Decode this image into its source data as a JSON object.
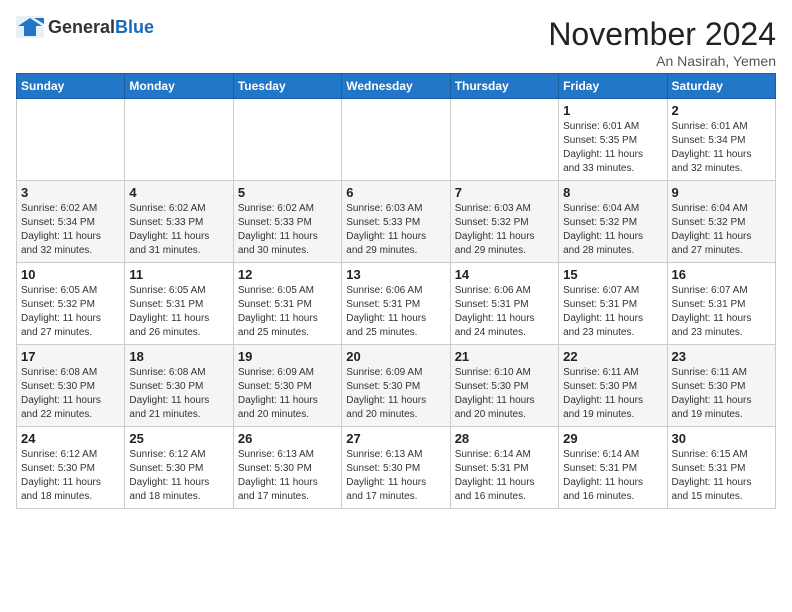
{
  "header": {
    "logo_general": "General",
    "logo_blue": "Blue",
    "month": "November 2024",
    "location": "An Nasirah, Yemen"
  },
  "weekdays": [
    "Sunday",
    "Monday",
    "Tuesday",
    "Wednesday",
    "Thursday",
    "Friday",
    "Saturday"
  ],
  "weeks": [
    [
      {
        "day": "",
        "info": ""
      },
      {
        "day": "",
        "info": ""
      },
      {
        "day": "",
        "info": ""
      },
      {
        "day": "",
        "info": ""
      },
      {
        "day": "",
        "info": ""
      },
      {
        "day": "1",
        "info": "Sunrise: 6:01 AM\nSunset: 5:35 PM\nDaylight: 11 hours\nand 33 minutes."
      },
      {
        "day": "2",
        "info": "Sunrise: 6:01 AM\nSunset: 5:34 PM\nDaylight: 11 hours\nand 32 minutes."
      }
    ],
    [
      {
        "day": "3",
        "info": "Sunrise: 6:02 AM\nSunset: 5:34 PM\nDaylight: 11 hours\nand 32 minutes."
      },
      {
        "day": "4",
        "info": "Sunrise: 6:02 AM\nSunset: 5:33 PM\nDaylight: 11 hours\nand 31 minutes."
      },
      {
        "day": "5",
        "info": "Sunrise: 6:02 AM\nSunset: 5:33 PM\nDaylight: 11 hours\nand 30 minutes."
      },
      {
        "day": "6",
        "info": "Sunrise: 6:03 AM\nSunset: 5:33 PM\nDaylight: 11 hours\nand 29 minutes."
      },
      {
        "day": "7",
        "info": "Sunrise: 6:03 AM\nSunset: 5:32 PM\nDaylight: 11 hours\nand 29 minutes."
      },
      {
        "day": "8",
        "info": "Sunrise: 6:04 AM\nSunset: 5:32 PM\nDaylight: 11 hours\nand 28 minutes."
      },
      {
        "day": "9",
        "info": "Sunrise: 6:04 AM\nSunset: 5:32 PM\nDaylight: 11 hours\nand 27 minutes."
      }
    ],
    [
      {
        "day": "10",
        "info": "Sunrise: 6:05 AM\nSunset: 5:32 PM\nDaylight: 11 hours\nand 27 minutes."
      },
      {
        "day": "11",
        "info": "Sunrise: 6:05 AM\nSunset: 5:31 PM\nDaylight: 11 hours\nand 26 minutes."
      },
      {
        "day": "12",
        "info": "Sunrise: 6:05 AM\nSunset: 5:31 PM\nDaylight: 11 hours\nand 25 minutes."
      },
      {
        "day": "13",
        "info": "Sunrise: 6:06 AM\nSunset: 5:31 PM\nDaylight: 11 hours\nand 25 minutes."
      },
      {
        "day": "14",
        "info": "Sunrise: 6:06 AM\nSunset: 5:31 PM\nDaylight: 11 hours\nand 24 minutes."
      },
      {
        "day": "15",
        "info": "Sunrise: 6:07 AM\nSunset: 5:31 PM\nDaylight: 11 hours\nand 23 minutes."
      },
      {
        "day": "16",
        "info": "Sunrise: 6:07 AM\nSunset: 5:31 PM\nDaylight: 11 hours\nand 23 minutes."
      }
    ],
    [
      {
        "day": "17",
        "info": "Sunrise: 6:08 AM\nSunset: 5:30 PM\nDaylight: 11 hours\nand 22 minutes."
      },
      {
        "day": "18",
        "info": "Sunrise: 6:08 AM\nSunset: 5:30 PM\nDaylight: 11 hours\nand 21 minutes."
      },
      {
        "day": "19",
        "info": "Sunrise: 6:09 AM\nSunset: 5:30 PM\nDaylight: 11 hours\nand 20 minutes."
      },
      {
        "day": "20",
        "info": "Sunrise: 6:09 AM\nSunset: 5:30 PM\nDaylight: 11 hours\nand 20 minutes."
      },
      {
        "day": "21",
        "info": "Sunrise: 6:10 AM\nSunset: 5:30 PM\nDaylight: 11 hours\nand 20 minutes."
      },
      {
        "day": "22",
        "info": "Sunrise: 6:11 AM\nSunset: 5:30 PM\nDaylight: 11 hours\nand 19 minutes."
      },
      {
        "day": "23",
        "info": "Sunrise: 6:11 AM\nSunset: 5:30 PM\nDaylight: 11 hours\nand 19 minutes."
      }
    ],
    [
      {
        "day": "24",
        "info": "Sunrise: 6:12 AM\nSunset: 5:30 PM\nDaylight: 11 hours\nand 18 minutes."
      },
      {
        "day": "25",
        "info": "Sunrise: 6:12 AM\nSunset: 5:30 PM\nDaylight: 11 hours\nand 18 minutes."
      },
      {
        "day": "26",
        "info": "Sunrise: 6:13 AM\nSunset: 5:30 PM\nDaylight: 11 hours\nand 17 minutes."
      },
      {
        "day": "27",
        "info": "Sunrise: 6:13 AM\nSunset: 5:30 PM\nDaylight: 11 hours\nand 17 minutes."
      },
      {
        "day": "28",
        "info": "Sunrise: 6:14 AM\nSunset: 5:31 PM\nDaylight: 11 hours\nand 16 minutes."
      },
      {
        "day": "29",
        "info": "Sunrise: 6:14 AM\nSunset: 5:31 PM\nDaylight: 11 hours\nand 16 minutes."
      },
      {
        "day": "30",
        "info": "Sunrise: 6:15 AM\nSunset: 5:31 PM\nDaylight: 11 hours\nand 15 minutes."
      }
    ]
  ]
}
